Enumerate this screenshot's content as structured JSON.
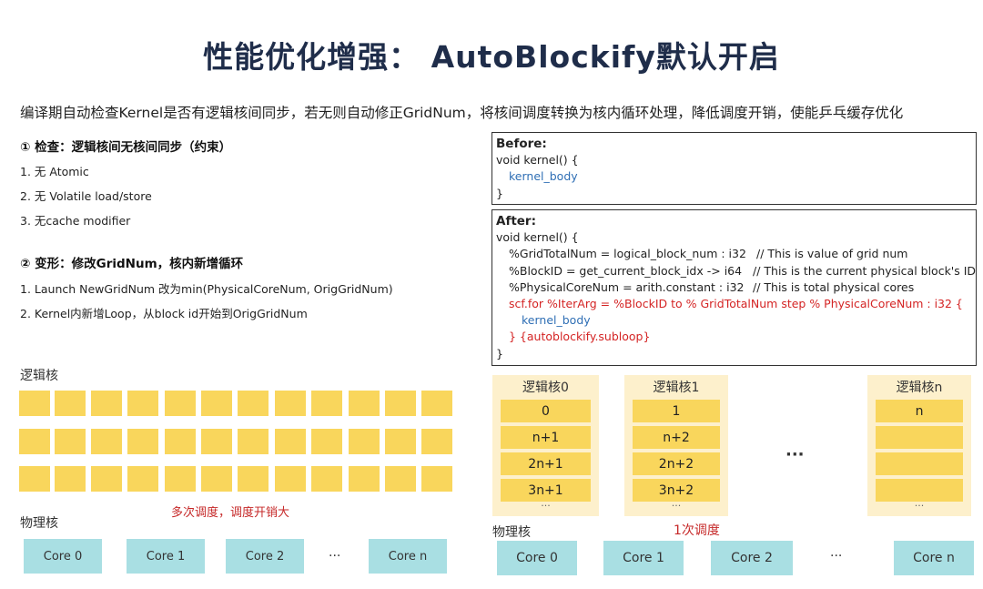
{
  "title": "性能优化增强： AutoBlockify默认开启",
  "subtitle": "编译期自动检查Kernel是否有逻辑核间同步，若无则自动修正GridNum，将核间调度转换为核内循环处理，降低调度开销，使能乒乓缓存优化",
  "check": {
    "title": "① 检查：逻辑核间无核间同步（约束）",
    "items": [
      "1. 无 Atomic",
      "2. 无 Volatile load/store",
      "3. 无cache modifier"
    ]
  },
  "transform": {
    "title": "② 变形：修改GridNum，核内新增循环",
    "items": [
      "1. Launch NewGridNum 改为min(PhysicalCoreNum, OrigGridNum)",
      "2. Kernel内新增Loop，从block id开始到OrigGridNum"
    ]
  },
  "before": {
    "header": "Before:",
    "line1": "void kernel() {",
    "line2": "kernel_body",
    "line3": "}"
  },
  "after": {
    "header": "After:",
    "line1": "void kernel() {",
    "code2": "%GridTotalNum = logical_block_num : i32",
    "cmt2": "// This is value of grid num",
    "code3": "%BlockID = get_current_block_idx -> i64",
    "cmt3": "// This is the current physical block's ID",
    "code4": "%PhysicalCoreNum = arith.constant : i32",
    "cmt4": "// This is total physical cores",
    "line5": "scf.for %IterArg = %BlockID to % GridTotalNum step % PhysicalCoreNum : i32 {",
    "line6": "kernel_body",
    "line7": "} {autoblockify.subloop}",
    "line8": "}"
  },
  "left_diagram": {
    "logical_label": "逻辑核",
    "physical_label": "物理核",
    "note": "多次调度，调度开销大",
    "cores": [
      "Core 0",
      "Core 1",
      "Core 2",
      "Core n"
    ],
    "ellipsis": "···"
  },
  "right_diagram": {
    "physical_label": "物理核",
    "note": "1次调度",
    "mid_ellipsis": "···",
    "cols": [
      {
        "header": "逻辑核0",
        "cells": [
          "0",
          "n+1",
          "2n+1",
          "3n+1"
        ],
        "more": "···"
      },
      {
        "header": "逻辑核1",
        "cells": [
          "1",
          "n+2",
          "2n+2",
          "3n+2"
        ],
        "more": "···"
      },
      {
        "header": "逻辑核n",
        "cells": [
          "n",
          "",
          "",
          ""
        ],
        "more": "···"
      }
    ],
    "cores": [
      "Core 0",
      "Core 1",
      "Core 2",
      "Core n"
    ],
    "core_ellipsis": "···"
  },
  "colors": {
    "logical_cell": "#f9d65c",
    "logical_column": "#fdf0cc",
    "physical_core": "#a9dfe3",
    "code_blue": "#2f6fb5",
    "code_red": "#d42424",
    "title": "#1f2d4a"
  }
}
